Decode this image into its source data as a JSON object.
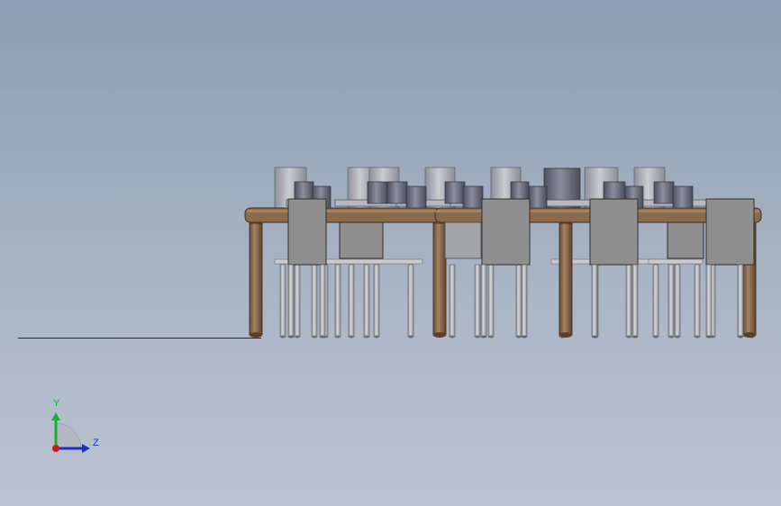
{
  "viewport": {
    "background_top": "#8e9db3",
    "background_bottom": "#bcc4d2"
  },
  "model": {
    "description_colors": {
      "table_top": "#8a6a4a",
      "table_leg": "#8a6748",
      "chair_panel": "#8f8f8f",
      "chair_leg": "#b9bcc2",
      "cup": "#a8acb4",
      "cup_dark": "#707480"
    }
  },
  "triad": {
    "y_label": "Y",
    "z_label": "Z",
    "y_color": "#18b030",
    "z_color": "#1a2fd0",
    "x_color": "#d01818"
  }
}
